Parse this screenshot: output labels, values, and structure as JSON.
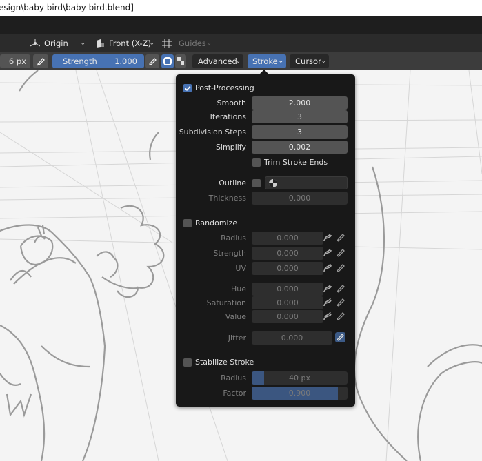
{
  "window": {
    "title": "esign\\baby bird\\baby bird.blend]"
  },
  "header": {
    "pivot_label": "Origin",
    "view_label": "Front (X-Z)",
    "guides_label": "Guides"
  },
  "toolbar": {
    "size_value": "6 px",
    "strength_label": "Strength",
    "strength_value": "1.000",
    "advanced_label": "Advanced",
    "stroke_label": "Stroke",
    "cursor_label": "Cursor"
  },
  "panel": {
    "post_processing": {
      "label": "Post-Processing",
      "checked": true,
      "smooth_label": "Smooth",
      "smooth_value": "2.000",
      "iterations_label": "Iterations",
      "iterations_value": "3",
      "subdivision_label": "Subdivision Steps",
      "subdivision_value": "3",
      "simplify_label": "Simplify",
      "simplify_value": "0.002",
      "trim_label": "Trim Stroke Ends",
      "trim_checked": false
    },
    "outline": {
      "label": "Outline",
      "checked": false,
      "thickness_label": "Thickness",
      "thickness_value": "0.000"
    },
    "randomize": {
      "label": "Randomize",
      "checked": false,
      "radius_label": "Radius",
      "radius_value": "0.000",
      "strength_label": "Strength",
      "strength_value": "0.000",
      "uv_label": "UV",
      "uv_value": "0.000",
      "hue_label": "Hue",
      "hue_value": "0.000",
      "saturation_label": "Saturation",
      "saturation_value": "0.000",
      "value_label": "Value",
      "value_value": "0.000",
      "jitter_label": "Jitter",
      "jitter_value": "0.000"
    },
    "stabilize": {
      "label": "Stabilize Stroke",
      "checked": false,
      "radius_label": "Radius",
      "radius_value": "40 px",
      "radius_fill": 0.13,
      "factor_label": "Factor",
      "factor_value": "0.900",
      "factor_fill": 0.9
    }
  },
  "colors": {
    "accent": "#4772b3",
    "panel_bg": "#181818",
    "field_bg": "#545454"
  }
}
